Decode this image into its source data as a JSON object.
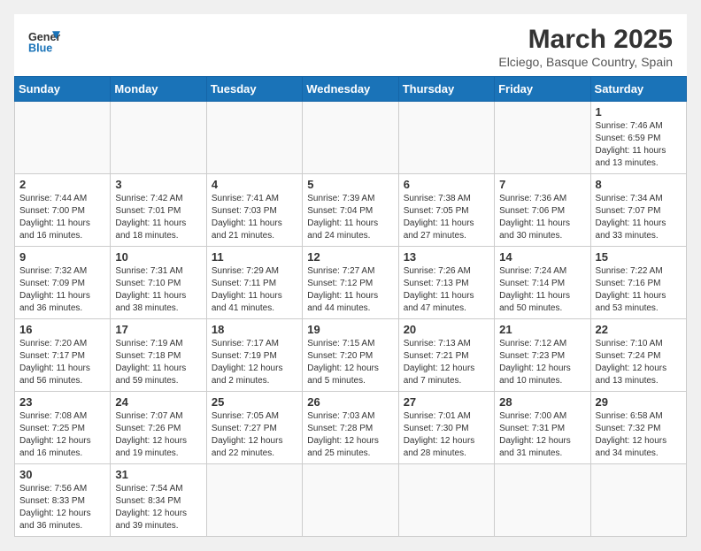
{
  "header": {
    "logo_general": "General",
    "logo_blue": "Blue",
    "month_title": "March 2025",
    "subtitle": "Elciego, Basque Country, Spain"
  },
  "weekdays": [
    "Sunday",
    "Monday",
    "Tuesday",
    "Wednesday",
    "Thursday",
    "Friday",
    "Saturday"
  ],
  "weeks": [
    [
      {
        "day": "",
        "info": ""
      },
      {
        "day": "",
        "info": ""
      },
      {
        "day": "",
        "info": ""
      },
      {
        "day": "",
        "info": ""
      },
      {
        "day": "",
        "info": ""
      },
      {
        "day": "",
        "info": ""
      },
      {
        "day": "1",
        "info": "Sunrise: 7:46 AM\nSunset: 6:59 PM\nDaylight: 11 hours and 13 minutes."
      }
    ],
    [
      {
        "day": "2",
        "info": "Sunrise: 7:44 AM\nSunset: 7:00 PM\nDaylight: 11 hours and 16 minutes."
      },
      {
        "day": "3",
        "info": "Sunrise: 7:42 AM\nSunset: 7:01 PM\nDaylight: 11 hours and 18 minutes."
      },
      {
        "day": "4",
        "info": "Sunrise: 7:41 AM\nSunset: 7:03 PM\nDaylight: 11 hours and 21 minutes."
      },
      {
        "day": "5",
        "info": "Sunrise: 7:39 AM\nSunset: 7:04 PM\nDaylight: 11 hours and 24 minutes."
      },
      {
        "day": "6",
        "info": "Sunrise: 7:38 AM\nSunset: 7:05 PM\nDaylight: 11 hours and 27 minutes."
      },
      {
        "day": "7",
        "info": "Sunrise: 7:36 AM\nSunset: 7:06 PM\nDaylight: 11 hours and 30 minutes."
      },
      {
        "day": "8",
        "info": "Sunrise: 7:34 AM\nSunset: 7:07 PM\nDaylight: 11 hours and 33 minutes."
      }
    ],
    [
      {
        "day": "9",
        "info": "Sunrise: 7:32 AM\nSunset: 7:09 PM\nDaylight: 11 hours and 36 minutes."
      },
      {
        "day": "10",
        "info": "Sunrise: 7:31 AM\nSunset: 7:10 PM\nDaylight: 11 hours and 38 minutes."
      },
      {
        "day": "11",
        "info": "Sunrise: 7:29 AM\nSunset: 7:11 PM\nDaylight: 11 hours and 41 minutes."
      },
      {
        "day": "12",
        "info": "Sunrise: 7:27 AM\nSunset: 7:12 PM\nDaylight: 11 hours and 44 minutes."
      },
      {
        "day": "13",
        "info": "Sunrise: 7:26 AM\nSunset: 7:13 PM\nDaylight: 11 hours and 47 minutes."
      },
      {
        "day": "14",
        "info": "Sunrise: 7:24 AM\nSunset: 7:14 PM\nDaylight: 11 hours and 50 minutes."
      },
      {
        "day": "15",
        "info": "Sunrise: 7:22 AM\nSunset: 7:16 PM\nDaylight: 11 hours and 53 minutes."
      }
    ],
    [
      {
        "day": "16",
        "info": "Sunrise: 7:20 AM\nSunset: 7:17 PM\nDaylight: 11 hours and 56 minutes."
      },
      {
        "day": "17",
        "info": "Sunrise: 7:19 AM\nSunset: 7:18 PM\nDaylight: 11 hours and 59 minutes."
      },
      {
        "day": "18",
        "info": "Sunrise: 7:17 AM\nSunset: 7:19 PM\nDaylight: 12 hours and 2 minutes."
      },
      {
        "day": "19",
        "info": "Sunrise: 7:15 AM\nSunset: 7:20 PM\nDaylight: 12 hours and 5 minutes."
      },
      {
        "day": "20",
        "info": "Sunrise: 7:13 AM\nSunset: 7:21 PM\nDaylight: 12 hours and 7 minutes."
      },
      {
        "day": "21",
        "info": "Sunrise: 7:12 AM\nSunset: 7:23 PM\nDaylight: 12 hours and 10 minutes."
      },
      {
        "day": "22",
        "info": "Sunrise: 7:10 AM\nSunset: 7:24 PM\nDaylight: 12 hours and 13 minutes."
      }
    ],
    [
      {
        "day": "23",
        "info": "Sunrise: 7:08 AM\nSunset: 7:25 PM\nDaylight: 12 hours and 16 minutes."
      },
      {
        "day": "24",
        "info": "Sunrise: 7:07 AM\nSunset: 7:26 PM\nDaylight: 12 hours and 19 minutes."
      },
      {
        "day": "25",
        "info": "Sunrise: 7:05 AM\nSunset: 7:27 PM\nDaylight: 12 hours and 22 minutes."
      },
      {
        "day": "26",
        "info": "Sunrise: 7:03 AM\nSunset: 7:28 PM\nDaylight: 12 hours and 25 minutes."
      },
      {
        "day": "27",
        "info": "Sunrise: 7:01 AM\nSunset: 7:30 PM\nDaylight: 12 hours and 28 minutes."
      },
      {
        "day": "28",
        "info": "Sunrise: 7:00 AM\nSunset: 7:31 PM\nDaylight: 12 hours and 31 minutes."
      },
      {
        "day": "29",
        "info": "Sunrise: 6:58 AM\nSunset: 7:32 PM\nDaylight: 12 hours and 34 minutes."
      }
    ],
    [
      {
        "day": "30",
        "info": "Sunrise: 7:56 AM\nSunset: 8:33 PM\nDaylight: 12 hours and 36 minutes."
      },
      {
        "day": "31",
        "info": "Sunrise: 7:54 AM\nSunset: 8:34 PM\nDaylight: 12 hours and 39 minutes."
      },
      {
        "day": "",
        "info": ""
      },
      {
        "day": "",
        "info": ""
      },
      {
        "day": "",
        "info": ""
      },
      {
        "day": "",
        "info": ""
      },
      {
        "day": "",
        "info": ""
      }
    ]
  ]
}
